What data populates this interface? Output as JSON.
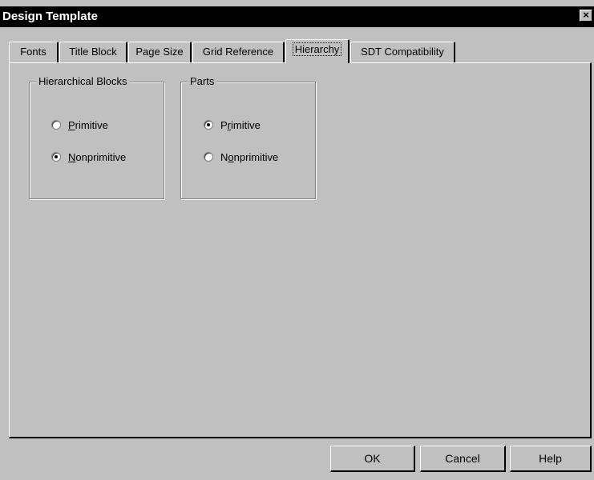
{
  "window": {
    "title": "Design Template",
    "close_glyph": "×"
  },
  "tabs": [
    {
      "label": "Fonts",
      "active": false
    },
    {
      "label": "Title Block",
      "active": false
    },
    {
      "label": "Page Size",
      "active": false
    },
    {
      "label": "Grid Reference",
      "active": false
    },
    {
      "label": "Hierarchy",
      "active": true
    },
    {
      "label": "SDT Compatibility",
      "active": false
    }
  ],
  "hierarchical_blocks": {
    "legend": "Hierarchical Blocks",
    "options": [
      {
        "pre": "",
        "mnemonic": "P",
        "post": "rimitive",
        "checked": false
      },
      {
        "pre": "",
        "mnemonic": "N",
        "post": "onprimitive",
        "checked": true
      }
    ]
  },
  "parts": {
    "legend": "Parts",
    "options": [
      {
        "pre": "P",
        "mnemonic": "r",
        "post": "imitive",
        "checked": true
      },
      {
        "pre": "N",
        "mnemonic": "o",
        "post": "nprimitive",
        "checked": false
      }
    ]
  },
  "buttons": {
    "ok": "OK",
    "cancel": "Cancel",
    "help": "Help"
  },
  "colors": {
    "face": "#c0c0c0",
    "titlebar": "#000000",
    "highlight": "#ffffff",
    "shadow": "#808080"
  }
}
